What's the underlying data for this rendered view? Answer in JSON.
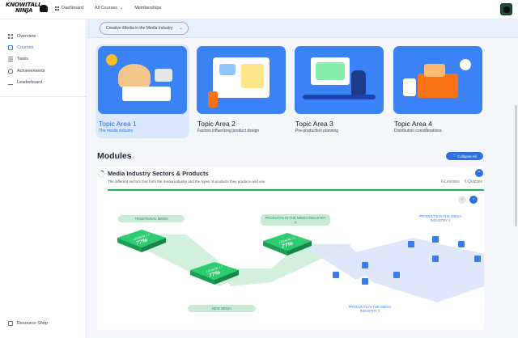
{
  "brand": {
    "line1": "KNOWITALL",
    "line2": "NINJA"
  },
  "topnav": {
    "dashboard": "Dashboard",
    "courses": "All Courses",
    "memberships": "Memberships"
  },
  "sidebar": {
    "items": [
      {
        "label": "Overview",
        "icon": "overview-icon"
      },
      {
        "label": "Courses",
        "icon": "courses-icon"
      },
      {
        "label": "Tasks",
        "icon": "tasks-icon"
      },
      {
        "label": "Achievements",
        "icon": "trophy-icon"
      },
      {
        "label": "Leaderboard",
        "icon": "podium-icon"
      }
    ],
    "shop": "Resource Shop"
  },
  "course_select": {
    "value": "Creative iMedia in the Media Industry"
  },
  "topics": [
    {
      "title": "Topic Area 1",
      "subtitle": "The media industry"
    },
    {
      "title": "Topic Area 2",
      "subtitle": "Factors influencing product design"
    },
    {
      "title": "Topic Area 3",
      "subtitle": "Pre-production planning"
    },
    {
      "title": "Topic Area 4",
      "subtitle": "Distribution considerations"
    }
  ],
  "modules": {
    "heading": "Modules",
    "collapse_label": "Collapse All",
    "module": {
      "title": "Media Industry Sectors & Products",
      "description": "The different sectors that form the media industry and the types of products they produce and use.",
      "lessons": "6 Lessons",
      "quizzes": "6 Quizzes",
      "progress_fraction": 0.15
    },
    "diagram": {
      "labels": {
        "traditional": "TRADITIONAL MEDIA",
        "products_1": "PRODUCTS IN THE MEDIA INDUSTRY 1",
        "products_2": "PRODUCTS IN THE MEDIA INDUSTRY 2",
        "products_3": "PRODUCTS IN THE MEDIA INDUSTRY 3",
        "new_media": "NEW MEDIA"
      },
      "tile_caption": "LESSON 1.1",
      "tile_value": "77%",
      "tile_value_2": "77%",
      "tile_value_3": "77%"
    }
  },
  "colors": {
    "accent": "#2f6fe0",
    "green": "#22b35a",
    "light_green": "#c8ecd3"
  }
}
